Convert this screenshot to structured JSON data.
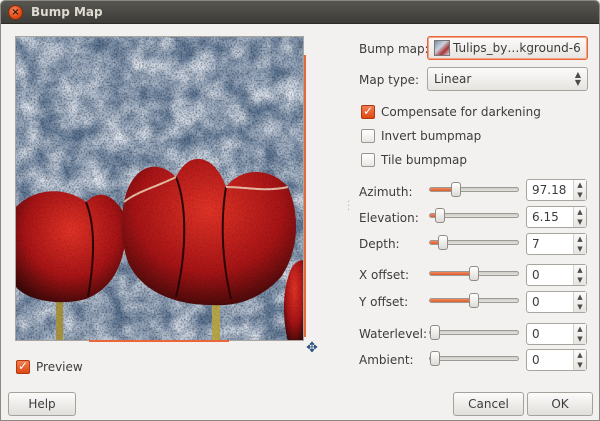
{
  "window": {
    "title": "Bump Map",
    "close_glyph": "×"
  },
  "preview": {
    "label": "Preview",
    "checked": true
  },
  "bump_map": {
    "label": "Bump map:",
    "value": "Tulips_by…kground-6"
  },
  "map_type": {
    "label": "Map type:",
    "value": "Linear"
  },
  "options": [
    {
      "label": "Compensate for darkening",
      "checked": true
    },
    {
      "label": "Invert bumpmap",
      "checked": false
    },
    {
      "label": "Tile bumpmap",
      "checked": false
    }
  ],
  "sliders": [
    {
      "label": "Azimuth:",
      "value": "97.18",
      "fraction": 0.27
    },
    {
      "label": "Elevation:",
      "value": "6.15",
      "fraction": 0.07
    },
    {
      "label": "Depth:",
      "value": "7",
      "fraction": 0.1
    },
    {
      "label": "X offset:",
      "value": "0",
      "fraction": 0.5
    },
    {
      "label": "Y offset:",
      "value": "0",
      "fraction": 0.5
    },
    {
      "label": "Waterlevel:",
      "value": "0",
      "fraction": 0.0
    },
    {
      "label": "Ambient:",
      "value": "0",
      "fraction": 0.0
    }
  ],
  "buttons": {
    "help": "Help",
    "cancel": "Cancel",
    "ok": "OK"
  },
  "icons": {
    "move": "move-cursor-icon",
    "spin": "spin-arrows-icon",
    "combo": "updown-arrows-icon"
  },
  "colors": {
    "accent": "#e9653a",
    "titlebar": "#3d3c38"
  }
}
